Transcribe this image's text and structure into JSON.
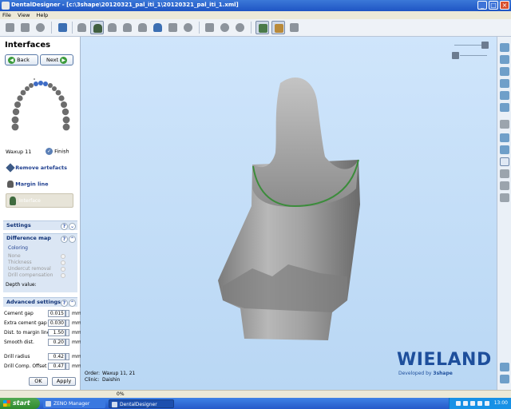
{
  "window": {
    "title": "DentalDesigner - [c:\\3shape\\20120321_pal_iti_1\\20120321_pal_iti_1.xml]",
    "minimize": "_",
    "maximize": "□",
    "close": "×"
  },
  "menu": [
    "File",
    "View",
    "Help"
  ],
  "toolbar": {
    "icons": [
      "open-icon",
      "save-icon",
      "scan-icon",
      "reload-icon",
      "preparation-icon",
      "abutment-icon",
      "tooth-icon",
      "tooth-outline-icon",
      "anatomy-icon",
      "connector-icon",
      "gingiva-icon",
      "disc-icon",
      "merge-icon",
      "sculpt-icon",
      "smooth-icon",
      "ruler-icon",
      "palette-icon",
      "arrow-icon"
    ],
    "selected": "abutment-icon"
  },
  "panel": {
    "title": "Interfaces",
    "back_label": "Back",
    "next_label": "Next",
    "tooth_label": "Waxup 11",
    "finish_label": "Finish",
    "tools": [
      {
        "label": "Remove artefacts",
        "icon": "brush-icon"
      },
      {
        "label": "Margin line",
        "icon": "pen-icon"
      },
      {
        "label": "Interface",
        "icon": "interface-icon"
      }
    ],
    "sections": {
      "settings": "Settings",
      "difference_map": "Difference map",
      "advanced": "Advanced settings"
    },
    "coloring_label": "Coloring",
    "coloring_options": [
      "None",
      "Thickness",
      "Undercut removal",
      "Drill compensation"
    ],
    "depth_label": "Depth value:",
    "fields": [
      {
        "label": "Cement gap",
        "value": "0.015",
        "unit": "mm"
      },
      {
        "label": "Extra cement gap",
        "value": "0.030",
        "unit": "mm"
      },
      {
        "label": "Dist. to margin line",
        "value": "1.50",
        "unit": "mm"
      },
      {
        "label": "Smooth dist.",
        "value": "0.20",
        "unit": "mm"
      },
      {
        "label": "Drill radius",
        "value": "0.42",
        "unit": "mm"
      },
      {
        "label": "Drill Comp. Offset",
        "value": "0.47",
        "unit": "mm"
      }
    ],
    "ok_label": "OK",
    "apply_label": "Apply"
  },
  "viewport": {
    "order_label": "Order:",
    "order_value": "Waxup 11, 21",
    "clinic_label": "Clinic:",
    "clinic_value": "Daishin",
    "brand": "WIELAND",
    "brand_sub": "Developed by",
    "brand_sub_strong": "3shape",
    "colors": {
      "background": "#c6dff8",
      "model": "#9a9a9a",
      "margin": "#3b8c3b",
      "brand": "#1e4f9c"
    }
  },
  "right_panel": {
    "icons": [
      "view-front-icon",
      "view-back-icon",
      "view-left-icon",
      "view-right-icon",
      "view-top-icon",
      "view-bottom-icon",
      "fit-icon",
      "transparency-icon",
      "clip-icon",
      "eye-icon",
      "triangle-icon",
      "square-icon",
      "cube-icon",
      "settings-icon",
      "export-icon"
    ]
  },
  "status": {
    "progress": "0%"
  },
  "taskbar": {
    "start": "start",
    "tasks": [
      "ZENO Manager",
      "DentalDesigner"
    ],
    "clock": "13:00"
  }
}
